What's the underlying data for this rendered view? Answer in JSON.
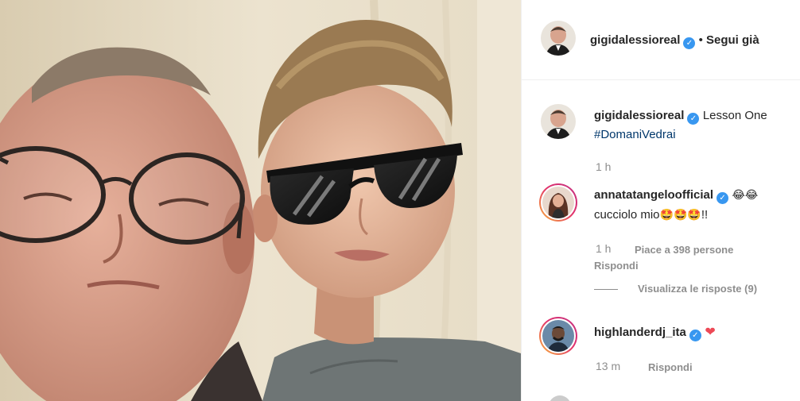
{
  "post": {
    "author": "gigidalessioreal",
    "follow_status": "Segui già",
    "separator": "•"
  },
  "caption": {
    "author": "gigidalessioreal",
    "text": "Lesson One",
    "hashtag": "#DomaniVedrai",
    "time": "1 h"
  },
  "comments": [
    {
      "user": "annatatangeloofficial",
      "text_line2": "cucciolo mio",
      "text_suffix": "!!",
      "time": "1 h",
      "likes": "Piace a 398 persone",
      "reply": "Rispondi",
      "view_replies": "Visualizza le risposte (9)"
    },
    {
      "user": "highlanderdj_ita",
      "time": "13 m",
      "reply": "Rispondi"
    }
  ],
  "icons": {
    "verified": "verified-badge-icon",
    "laugh": "laughing-emoji-icon",
    "star_eyes": "star-struck-emoji-icon",
    "heart": "red-heart-icon"
  },
  "colors": {
    "verified": "#3897f0",
    "link": "#00376b",
    "secondary": "#8e8e8e",
    "heart": "#ed4956"
  }
}
